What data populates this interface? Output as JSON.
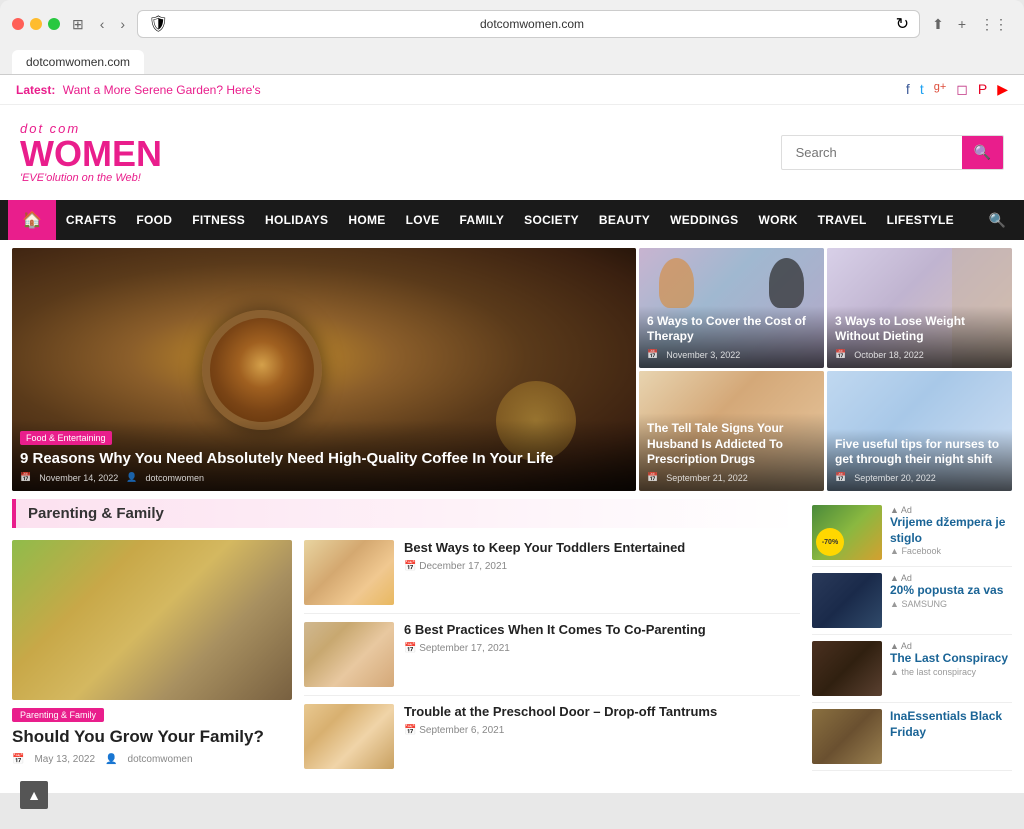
{
  "browser": {
    "url": "dotcomwomen.com",
    "tab_title": "dotcomwomen.com"
  },
  "topbar": {
    "latest_label": "Latest:",
    "latest_article": "Want a More Serene Garden? Here's",
    "social": [
      "f",
      "t",
      "g+",
      "ig",
      "p",
      "yt"
    ]
  },
  "header": {
    "logo_top": "dot com",
    "logo_main": "WOMEN",
    "logo_tagline": "'EVE'olution on the Web!",
    "search_placeholder": "Search"
  },
  "nav": {
    "home_icon": "🏠",
    "items": [
      "CRAFTS",
      "FOOD",
      "FITNESS",
      "HOLIDAYS",
      "HOME",
      "LOVE",
      "FAMILY",
      "SOCIETY",
      "BEAUTY",
      "WEDDINGS",
      "WORK",
      "TRAVEL",
      "LIFESTYLE"
    ],
    "search_icon": "🔍"
  },
  "featured": {
    "main": {
      "tag": "Food & Entertaining",
      "title": "9 Reasons Why You Need Absolutely Need High-Quality Coffee In Your Life",
      "date": "November 14, 2022",
      "author": "dotcomwomen"
    },
    "cards": [
      {
        "title": "6 Ways to Cover the Cost of Therapy",
        "date": "November 3, 2022"
      },
      {
        "title": "3 Ways to Lose Weight Without Dieting",
        "date": "October 18, 2022"
      },
      {
        "title": "The Tell Tale Signs Your Husband Is Addicted To Prescription Drugs",
        "date": "September 21, 2022"
      },
      {
        "title": "Five useful tips for nurses to get through their night shift",
        "date": "September 20, 2022"
      }
    ]
  },
  "parenting_section": {
    "label": "Parenting & Family",
    "main_article": {
      "tag": "Parenting & Family",
      "title": "Should You Grow Your Family?",
      "date": "May 13, 2022",
      "author": "dotcomwomen"
    },
    "articles": [
      {
        "title": "Best Ways to Keep Your Toddlers Entertained",
        "date": "December 17, 2021"
      },
      {
        "title": "6 Best Practices When It Comes To Co-Parenting",
        "date": "September 17, 2021"
      },
      {
        "title": "Trouble at the Preschool Door – Drop-off Tantrums",
        "date": "September 6, 2021"
      }
    ]
  },
  "ads": {
    "items": [
      {
        "title": "Vrijeme džempera je stiglo",
        "sponsor": "Facebook",
        "badge": "-70%"
      },
      {
        "title": "20% popusta za vas",
        "sponsor": "SAMSUNG"
      },
      {
        "title": "The Last Conspiracy",
        "sponsor": "the last conspiracy"
      },
      {
        "title": "InaEssentials Black Friday",
        "sponsor": ""
      }
    ]
  }
}
